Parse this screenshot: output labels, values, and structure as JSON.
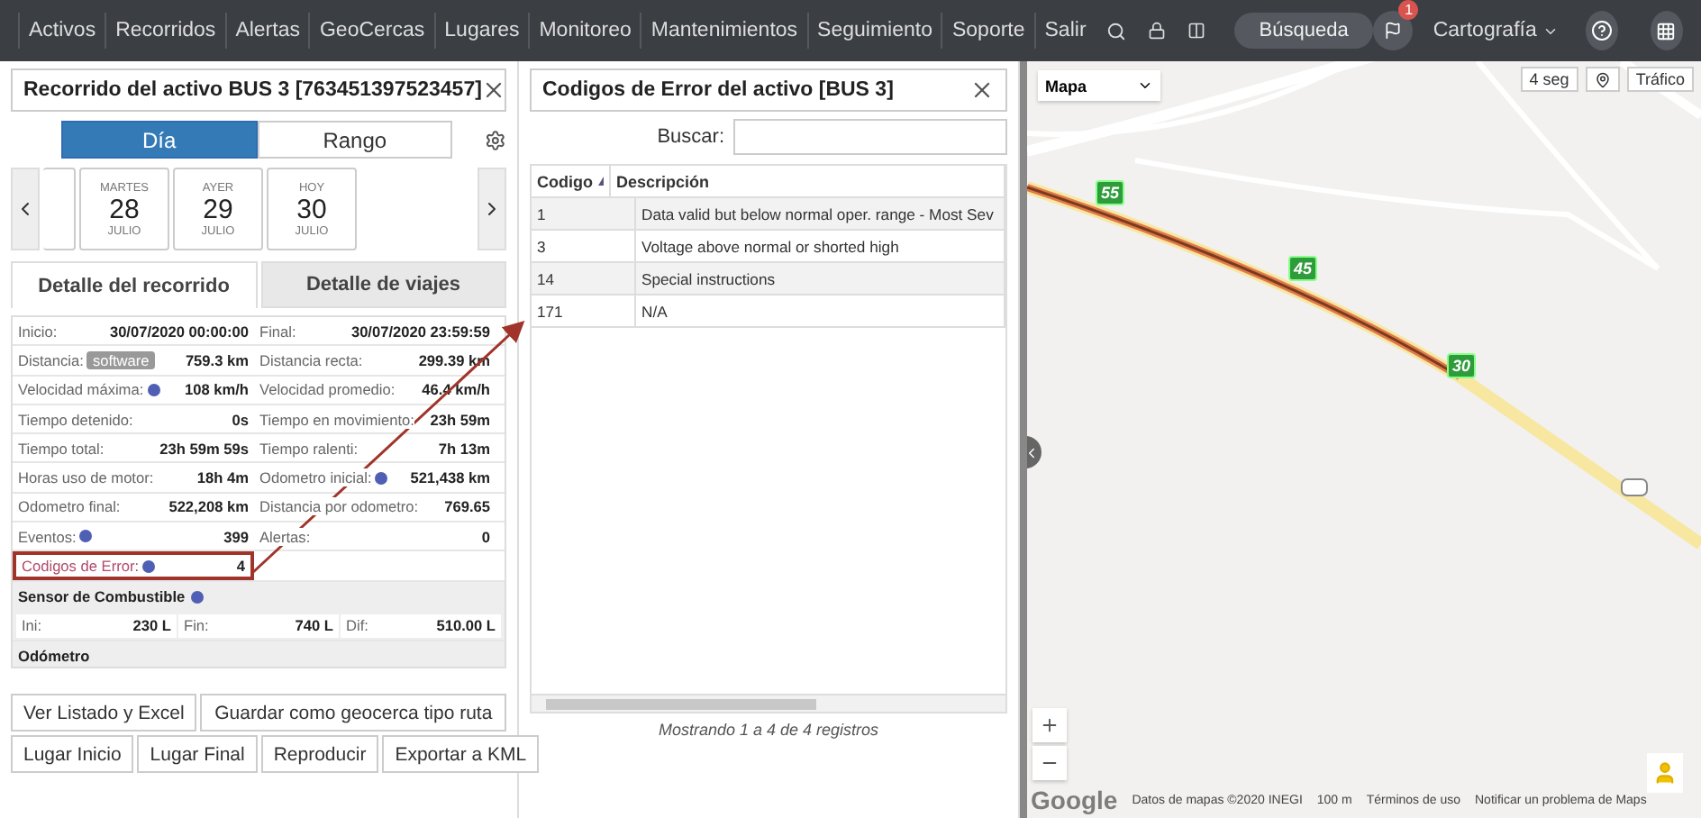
{
  "nav": {
    "items": [
      "Activos",
      "Recorridos",
      "Alertas",
      "GeoCercas",
      "Lugares",
      "Monitoreo",
      "Mantenimientos",
      "Seguimiento",
      "Soporte",
      "Salir"
    ],
    "search_button": "Búsqueda",
    "notification_count": "1",
    "layer_menu": "Cartografía"
  },
  "trip_panel": {
    "title": "Recorrido del activo BUS 3 [763451397523457]",
    "mode_toggle": [
      {
        "label": "Día",
        "selected": true
      },
      {
        "label": "Rango",
        "selected": false
      }
    ],
    "dates": [
      {
        "weekday": "MARTES",
        "day": "28",
        "month": "JULIO"
      },
      {
        "weekday": "AYER",
        "day": "29",
        "month": "JULIO"
      },
      {
        "weekday": "HOY",
        "day": "30",
        "month": "JULIO"
      }
    ],
    "tabs": [
      {
        "label": "Detalle del recorrido",
        "selected": true
      },
      {
        "label": "Detalle de viajes",
        "selected": false
      }
    ],
    "stats": [
      [
        {
          "label": "Inicio:",
          "value": "30/07/2020 00:00:00",
          "info": false
        },
        {
          "label": "Final:",
          "value": "30/07/2020 23:59:59",
          "info": false
        }
      ],
      [
        {
          "label": "Distancia:",
          "badge": "software",
          "value": "759.3 km",
          "info": false
        },
        {
          "label": "Distancia recta:",
          "value": "299.39 km",
          "info": false
        }
      ],
      [
        {
          "label": "Velocidad máxima:",
          "value": "108 km/h",
          "info": true
        },
        {
          "label": "Velocidad promedio:",
          "value": "46.4 km/h",
          "info": false
        }
      ],
      [
        {
          "label": "Tiempo detenido:",
          "value": "0s",
          "info": false
        },
        {
          "label": "Tiempo en movimiento:",
          "value": "23h 59m",
          "info": false
        }
      ],
      [
        {
          "label": "Tiempo total:",
          "value": "23h 59m 59s",
          "info": false
        },
        {
          "label": "Tiempo ralenti:",
          "value": "7h 13m",
          "info": false
        }
      ],
      [
        {
          "label": "Horas uso de motor:",
          "value": "18h 4m",
          "info": false
        },
        {
          "label": "Odometro inicial:",
          "value": "521,438 km",
          "info": true
        }
      ],
      [
        {
          "label": "Odometro final:",
          "value": "522,208 km",
          "info": false
        },
        {
          "label": "Distancia por odometro:",
          "value": "769.65",
          "info": false
        }
      ],
      [
        {
          "label": "Eventos:",
          "value": "399",
          "info": true
        },
        {
          "label": "Alertas:",
          "value": "0",
          "info": false
        }
      ],
      [
        {
          "label": "Codigos de Error:",
          "value": "4",
          "info": true,
          "highlighted": true
        }
      ]
    ],
    "fuel": {
      "title": "Sensor de Combustible",
      "cells": [
        {
          "label": "Ini:",
          "value": "230 L"
        },
        {
          "label": "Fin:",
          "value": "740 L"
        },
        {
          "label": "Dif:",
          "value": "510.00 L"
        }
      ]
    },
    "odometer_title": "Odómetro",
    "buttons": [
      [
        "Ver Listado y Excel",
        "Guardar como geocerca tipo ruta"
      ],
      [
        "Lugar Inicio",
        "Lugar Final",
        "Reproducir",
        "Exportar a KML"
      ]
    ]
  },
  "error_panel": {
    "title": "Codigos de Error del activo [BUS 3]",
    "search_label": "Buscar:",
    "columns": [
      {
        "label": "Codigo",
        "sorted": true
      },
      {
        "label": "Descripción",
        "sorted": false
      }
    ],
    "rows": [
      {
        "code": "1",
        "description": "Data valid but below normal oper. range - Most Sev"
      },
      {
        "code": "3",
        "description": "Voltage above normal or shorted high"
      },
      {
        "code": "14",
        "description": "Special instructions"
      },
      {
        "code": "171",
        "description": "N/A"
      }
    ],
    "footer": "Mostrando 1 a 4 de 4 registros"
  },
  "map": {
    "map_type": "Mapa",
    "refresh": "4 seg",
    "traffic": "Tráfico",
    "markers": [
      {
        "label": "55"
      },
      {
        "label": "45"
      },
      {
        "label": "30"
      }
    ],
    "logo": "Google",
    "attribution": [
      "Datos de mapas ©2020 INEGI",
      "100 m",
      "Términos de uso",
      "Notificar un problema de Maps"
    ]
  }
}
